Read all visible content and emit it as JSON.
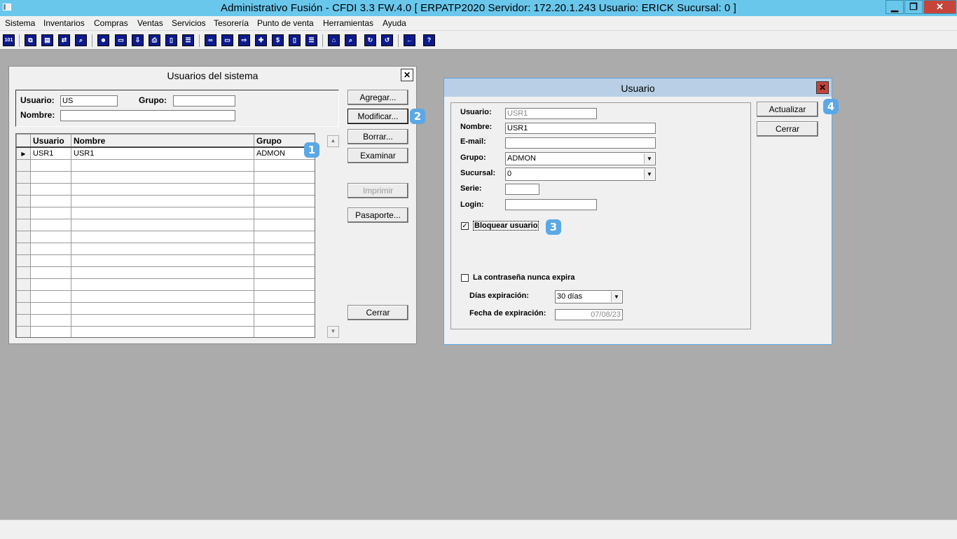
{
  "window": {
    "title": "Administrativo Fusión - CFDI 3.3 FW.4.0 [ ERPATP2020   Servidor: 172.20.1.243    Usuario: ERICK     Sucursal: 0 ]",
    "minimize": "▁",
    "maximize": "❐",
    "close": "✕"
  },
  "menu": [
    "Sistema",
    "Inventarios",
    "Compras",
    "Ventas",
    "Servicios",
    "Tesorería",
    "Punto de venta",
    "Herramientas",
    "Ayuda"
  ],
  "toolbar_first_label": "101",
  "users_dialog": {
    "title": "Usuarios del sistema",
    "close": "✕",
    "filter": {
      "usuario_label": "Usuario:",
      "usuario_value": "US",
      "grupo_label": "Grupo:",
      "grupo_value": "",
      "nombre_label": "Nombre:",
      "nombre_value": ""
    },
    "grid": {
      "columns": [
        "Usuario",
        "Nombre",
        "Grupo"
      ],
      "rows": [
        {
          "indicator": "▶",
          "usuario": "USR1",
          "nombre": "USR1",
          "grupo": "ADMON"
        }
      ]
    },
    "buttons": {
      "agregar": "Agregar...",
      "modificar": "Modificar...",
      "borrar": "Borrar...",
      "examinar": "Examinar",
      "imprimir": "Imprimir",
      "pasaporte": "Pasaporte...",
      "cerrar": "Cerrar"
    }
  },
  "user_dialog": {
    "title": "Usuario",
    "close": "✕",
    "fields": {
      "usuario_label": "Usuario:",
      "usuario_value": "USR1",
      "nombre_label": "Nombre:",
      "nombre_value": "USR1",
      "email_label": "E-mail:",
      "email_value": "",
      "grupo_label": "Grupo:",
      "grupo_value": "ADMON",
      "sucursal_label": "Sucursal:",
      "sucursal_value": "0",
      "serie_label": "Serie:",
      "serie_value": "",
      "login_label": "Login:",
      "login_value": ""
    },
    "bloquear_label": "Bloquear usuario",
    "bloquear_checked": "✓",
    "nunca_expira_label": "La contraseña nunca expira",
    "dias_label": "Días expiración:",
    "dias_value": "30 días",
    "fecha_label": "Fecha de expiración:",
    "fecha_value": "07/08/23",
    "buttons": {
      "actualizar": "Actualizar",
      "cerrar": "Cerrar"
    }
  },
  "badges": [
    "1",
    "2",
    "3",
    "4"
  ],
  "colors": {
    "titlebar": "#69c7ec",
    "badge": "#5aa8e6",
    "close": "#c7443a"
  }
}
